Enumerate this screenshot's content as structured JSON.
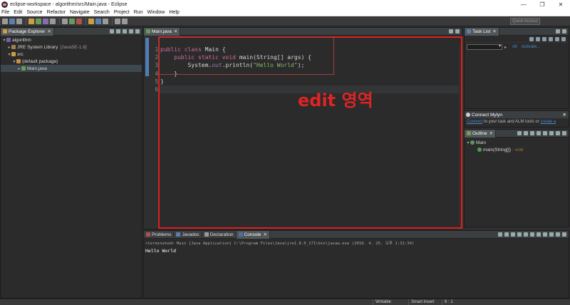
{
  "window": {
    "title": "eclipse-workspace - algorithm/src/Main.java - Eclipse",
    "minimize": "—",
    "maximize": "❐",
    "close": "✕"
  },
  "menu": [
    "File",
    "Edit",
    "Source",
    "Refactor",
    "Navigate",
    "Search",
    "Project",
    "Run",
    "Window",
    "Help"
  ],
  "toolbar": {
    "quick_access_placeholder": "Quick Access"
  },
  "package_explorer": {
    "tab": "Package Explorer",
    "close": "✕",
    "tree": {
      "project": "algorithm",
      "jre": "JRE System Library",
      "jre_version": "[JavaSE-1.8]",
      "src": "src",
      "package": "(default package)",
      "file": "Main.java"
    }
  },
  "editor": {
    "tab": "Main.java",
    "close": "✕",
    "line_numbers": [
      "1",
      "2",
      "3",
      "4",
      "5",
      "6"
    ],
    "annotation": "edit 영역"
  },
  "console": {
    "tabs": [
      "Problems",
      "Javadoc",
      "Declaration",
      "Console"
    ],
    "close": "✕",
    "terminated": "<terminated> Main [Java Application] C:\\Program Files\\Java\\jre1.8.0_171\\bin\\javaw.exe (2018. 4. 25. 오후 1:31:34)",
    "output": "Hello World"
  },
  "task_list": {
    "tab": "Task List",
    "close": "✕",
    "filter_all": "All",
    "filter_activate": "Activate..."
  },
  "mylyn": {
    "title": "Connect Mylyn",
    "close": "✕",
    "connect_link": "Connect",
    "text_middle": " to your task and ALM tools or ",
    "create_link": "create a"
  },
  "outline": {
    "tab": "Outline",
    "close": "✕",
    "class_name": "Main",
    "method": "main(String[])",
    "method_type": ": void"
  },
  "status": {
    "writable": "Writable",
    "insert_mode": "Smart Insert",
    "position": "6 : 1"
  },
  "colors": {
    "highlight_red": "#e02020",
    "keyword": "#d16a9c",
    "string": "#86b86a",
    "link": "#4a88c7"
  }
}
